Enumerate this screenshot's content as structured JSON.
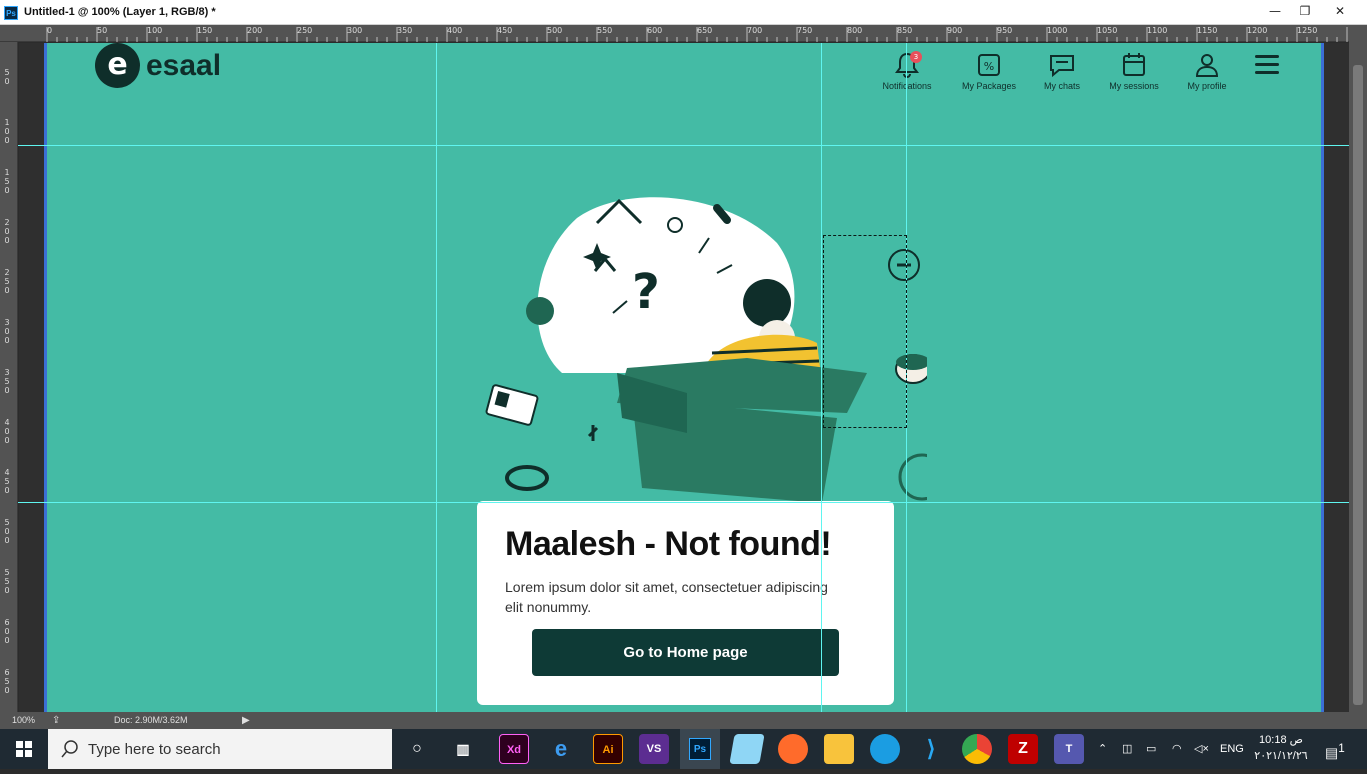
{
  "window": {
    "title": "Untitled-1 @ 100% (Layer 1, RGB/8) *",
    "app_badge": "Ps",
    "minimize": "—",
    "restore": "❐",
    "close": "✕"
  },
  "ruler": {
    "top_labels": [
      "0",
      "50",
      "100",
      "150",
      "200",
      "250",
      "300",
      "350",
      "400",
      "450",
      "500",
      "550",
      "600",
      "650",
      "700",
      "750",
      "800",
      "850",
      "900",
      "950",
      "1000",
      "1050",
      "1100",
      "1150",
      "1200",
      "1250"
    ],
    "left_labels": [
      "5\n0",
      "1\n0\n0",
      "1\n5\n0",
      "2\n0\n0",
      "2\n5\n0",
      "3\n0\n0",
      "3\n5\n0",
      "4\n0\n0",
      "4\n5\n0",
      "5\n0\n0",
      "5\n5\n0",
      "6\n0\n0",
      "6\n5\n0"
    ]
  },
  "site": {
    "logo_mark": "e",
    "logo_text": "esaal",
    "notif_count": "3",
    "nav": [
      {
        "label": "Notifications",
        "icon": "bell-icon",
        "glyph": "🔔"
      },
      {
        "label": "My Packages",
        "icon": "package-icon",
        "glyph": "▣"
      },
      {
        "label": "My chats",
        "icon": "chat-icon",
        "glyph": "▭"
      },
      {
        "label": "My sessions",
        "icon": "calendar-icon",
        "glyph": "▦"
      },
      {
        "label": "My profile",
        "icon": "user-icon",
        "glyph": "♙"
      }
    ],
    "card": {
      "title": "Maalesh - Not found!",
      "body": "Lorem ipsum dolor sit amet, consectetuer adipiscing elit nonummy.",
      "button": "Go to Home page"
    }
  },
  "colors": {
    "brand_bg": "#44bba5",
    "dark": "#0f2e2a",
    "button": "#0e3a36",
    "guide": "#5ff5f0"
  },
  "statusbar": {
    "zoom": "100%",
    "doc": "Doc: 2.90M/3.62M"
  },
  "taskbar": {
    "search_placeholder": "Type here to search",
    "apps": [
      "Xd",
      "Ai",
      "VS",
      "Ps",
      "Notes",
      "Firefox",
      "Files",
      "Edge",
      "VS Code",
      "Chrome",
      "FileZilla",
      "Teams"
    ],
    "lang": "ENG",
    "time": "10:18 ص",
    "date": "٢٠٢١/١٢/٢٦",
    "notif_count": "1"
  }
}
